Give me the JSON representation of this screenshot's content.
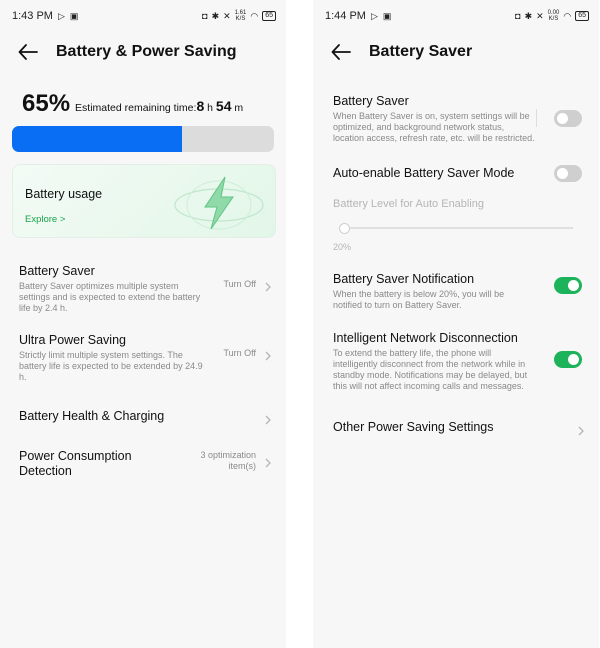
{
  "left": {
    "status": {
      "time": "1:43 PM",
      "speed": "1.61\nK/S",
      "battery": "65"
    },
    "header": {
      "title": "Battery & Power Saving"
    },
    "summary": {
      "percent": "65%",
      "estimate_label": "Estimated remaining time:",
      "hours": "8",
      "h_unit": "h",
      "minutes": "54",
      "m_unit": "m",
      "level": 0.65
    },
    "card": {
      "title": "Battery usage",
      "link": "Explore >"
    },
    "items": [
      {
        "title": "Battery Saver",
        "desc": "Battery Saver optimizes multiple system settings and is expected to extend the battery life by 2.4 h.",
        "value": "Turn Off"
      },
      {
        "title": "Ultra Power Saving",
        "desc": "Strictly limit multiple system settings. The battery life is expected to be extended by 24.9 h.",
        "value": "Turn Off"
      },
      {
        "title": "Battery Health & Charging",
        "desc": "",
        "value": ""
      },
      {
        "title": "Power Consumption Detection",
        "desc": "",
        "value": "3 optimization item(s)"
      }
    ]
  },
  "right": {
    "status": {
      "time": "1:44 PM",
      "speed": "0.00\nK/S",
      "battery": "65"
    },
    "header": {
      "title": "Battery Saver"
    },
    "items": [
      {
        "title": "Battery Saver",
        "desc": "When Battery Saver is on, system settings will be optimized, and background network status, location access, refresh rate, etc. will be restricted.",
        "state": "off"
      },
      {
        "title": "Auto-enable Battery Saver Mode",
        "desc": "",
        "state": "off"
      },
      {
        "title": "Battery Level for Auto Enabling",
        "slider_value": "20%"
      },
      {
        "title": "Battery Saver Notification",
        "desc": "When the battery is below 20%, you will be notified to turn on Battery Saver.",
        "state": "on"
      },
      {
        "title": "Intelligent Network Disconnection",
        "desc": "To extend the battery life, the phone will intelligently disconnect from the network while in standby mode. Notifications may be delayed, but this will not affect incoming calls and messages.",
        "state": "on"
      },
      {
        "title": "Other Power Saving Settings",
        "desc": ""
      }
    ]
  },
  "colors": {
    "accent_blue": "#0a6ef5",
    "toggle_on": "#1db35a",
    "link_green": "#1aa34a"
  }
}
